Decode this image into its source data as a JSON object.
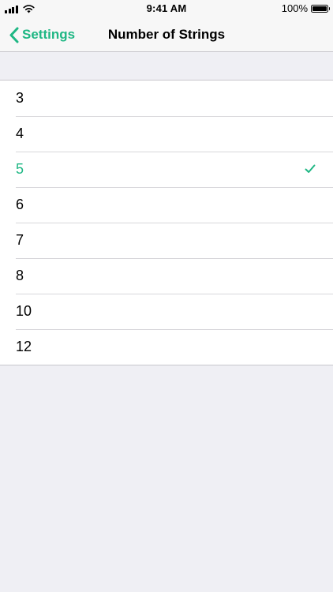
{
  "status_bar": {
    "time": "9:41 AM",
    "battery_text": "100%",
    "battery_level": 1.0,
    "signal_icon": "cellular-signal-icon",
    "wifi_icon": "wifi-icon"
  },
  "nav": {
    "back_label": "Settings",
    "back_icon": "chevron-left-icon",
    "title": "Number of Strings"
  },
  "options": [
    {
      "label": "3",
      "selected": false
    },
    {
      "label": "4",
      "selected": false
    },
    {
      "label": "5",
      "selected": true
    },
    {
      "label": "6",
      "selected": false
    },
    {
      "label": "7",
      "selected": false
    },
    {
      "label": "8",
      "selected": false
    },
    {
      "label": "10",
      "selected": false
    },
    {
      "label": "12",
      "selected": false
    }
  ],
  "colors": {
    "accent": "#1fb784",
    "background": "#efeff4",
    "bar_background": "#f7f7f7",
    "separator": "#c8c7cc"
  }
}
